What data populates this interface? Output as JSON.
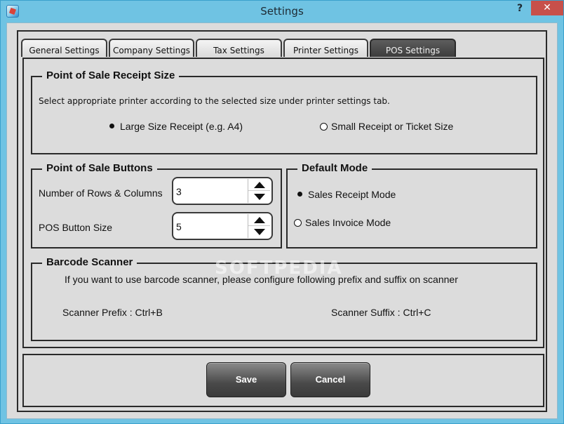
{
  "window": {
    "title": "Settings",
    "help_label": "?",
    "close_label": "✕"
  },
  "tabs": [
    {
      "label": "General Settings",
      "active": false
    },
    {
      "label": "Company Settings",
      "active": false
    },
    {
      "label": "Tax Settings",
      "active": false
    },
    {
      "label": "Printer Settings",
      "active": false
    },
    {
      "label": "POS Settings",
      "active": true
    }
  ],
  "receipt_size": {
    "legend": "Point of Sale Receipt Size",
    "hint": "Select appropriate printer according to the selected size under printer settings tab.",
    "options": [
      {
        "label": "Large Size Receipt (e.g. A4)",
        "selected": true
      },
      {
        "label": "Small Receipt or Ticket Size",
        "selected": false
      }
    ]
  },
  "buttons_group": {
    "legend": "Point of Sale Buttons",
    "rows_label": "Number of Rows & Columns",
    "rows_value": "3",
    "size_label": "POS Button Size",
    "size_value": "5"
  },
  "default_mode": {
    "legend": "Default Mode",
    "options": [
      {
        "label": "Sales Receipt Mode",
        "selected": true
      },
      {
        "label": "Sales Invoice Mode",
        "selected": false
      }
    ]
  },
  "barcode": {
    "legend": "Barcode Scanner",
    "hint": "If you want to use barcode scanner, please configure following prefix and suffix on scanner",
    "prefix": "Scanner Prefix : Ctrl+B",
    "suffix": "Scanner Suffix : Ctrl+C"
  },
  "footer": {
    "save_label": "Save",
    "cancel_label": "Cancel"
  },
  "watermark": "SOFTPEDIA",
  "colors": {
    "titlebar": "#6fc3e3",
    "close": "#c7504a",
    "panel": "#dcdcdc",
    "active_tab": "#4a4a4a"
  }
}
